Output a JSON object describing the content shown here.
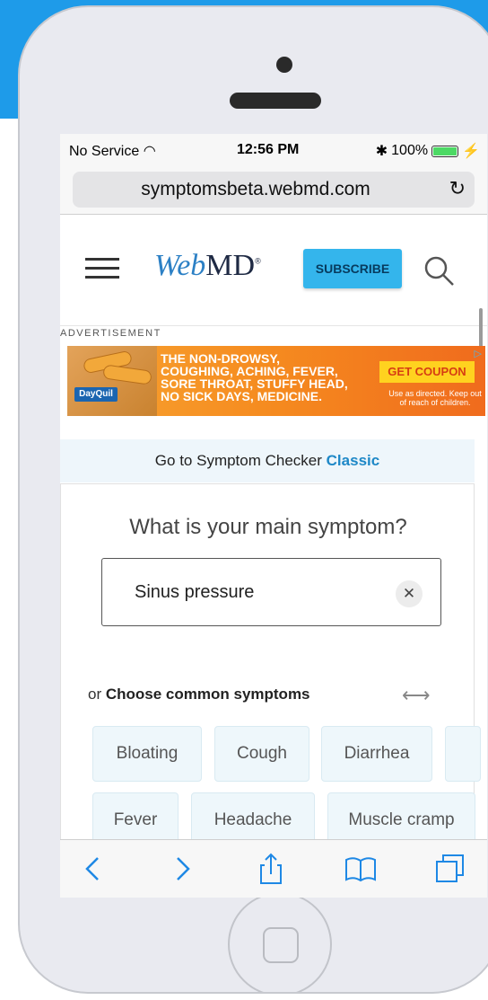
{
  "colors": {
    "background_accent": "#1e9be9",
    "subscribe_bg": "#34b5ec",
    "classic_link": "#1e88c7",
    "chip_bg": "#eef7fb"
  },
  "status_bar": {
    "carrier": "No Service",
    "time": "12:56 PM",
    "battery": "100%"
  },
  "browser": {
    "url": "symptomsbeta.webmd.com",
    "reload_icon": "reload-icon"
  },
  "header": {
    "logo_part1": "Web",
    "logo_part2": "MD",
    "subscribe_label": "SUBSCRIBE",
    "menu_icon": "hamburger-icon",
    "search_icon": "search-icon"
  },
  "ad": {
    "label": "ADVERTISEMENT",
    "brand": "DayQuil",
    "lines": [
      "THE NON-DROWSY,",
      "COUGHING, ACHING, FEVER,",
      "SORE THROAT, STUFFY HEAD,",
      "NO SICK DAYS, MEDICINE."
    ],
    "cta": "GET COUPON",
    "fine_print": "Use as directed. Keep out of reach of children."
  },
  "checker": {
    "classic_prefix": "Go to Symptom Checker",
    "classic_link": "Classic",
    "question": "What is your main symptom?",
    "input_value": "Sinus pressure",
    "clear_icon": "close-icon",
    "choose_prefix": "or",
    "choose_label": "Choose common symptoms",
    "scroll_icon": "left-right-arrow-icon",
    "chips_row1": [
      "Bloating",
      "Cough",
      "Diarrhea"
    ],
    "chips_row2": [
      "Fever",
      "Headache",
      "Muscle cramp"
    ]
  },
  "toolbar": {
    "icons": [
      "back-icon",
      "forward-icon",
      "share-icon",
      "bookmarks-icon",
      "tabs-icon"
    ]
  }
}
